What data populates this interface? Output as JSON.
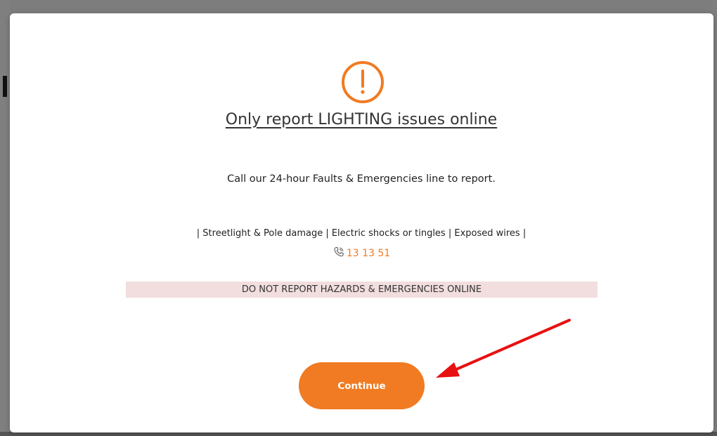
{
  "modal": {
    "title": "Only report LIGHTING issues online",
    "subtitle": "Call our 24-hour Faults & Emergencies line to report.",
    "hazards_line": "| Streetlight & Pole damage | Electric shocks or tingles | Exposed wires |",
    "phone_number": "13 13 51",
    "banner_text": "DO NOT REPORT HAZARDS & EMERGENCIES ONLINE",
    "continue_label": "Continue"
  },
  "icons": {
    "warning": "exclamation-circle-icon",
    "phone": "phone-icon"
  },
  "colors": {
    "accent": "#f07b22",
    "banner_bg": "#f2dede",
    "annotation_arrow": "#e81010"
  }
}
